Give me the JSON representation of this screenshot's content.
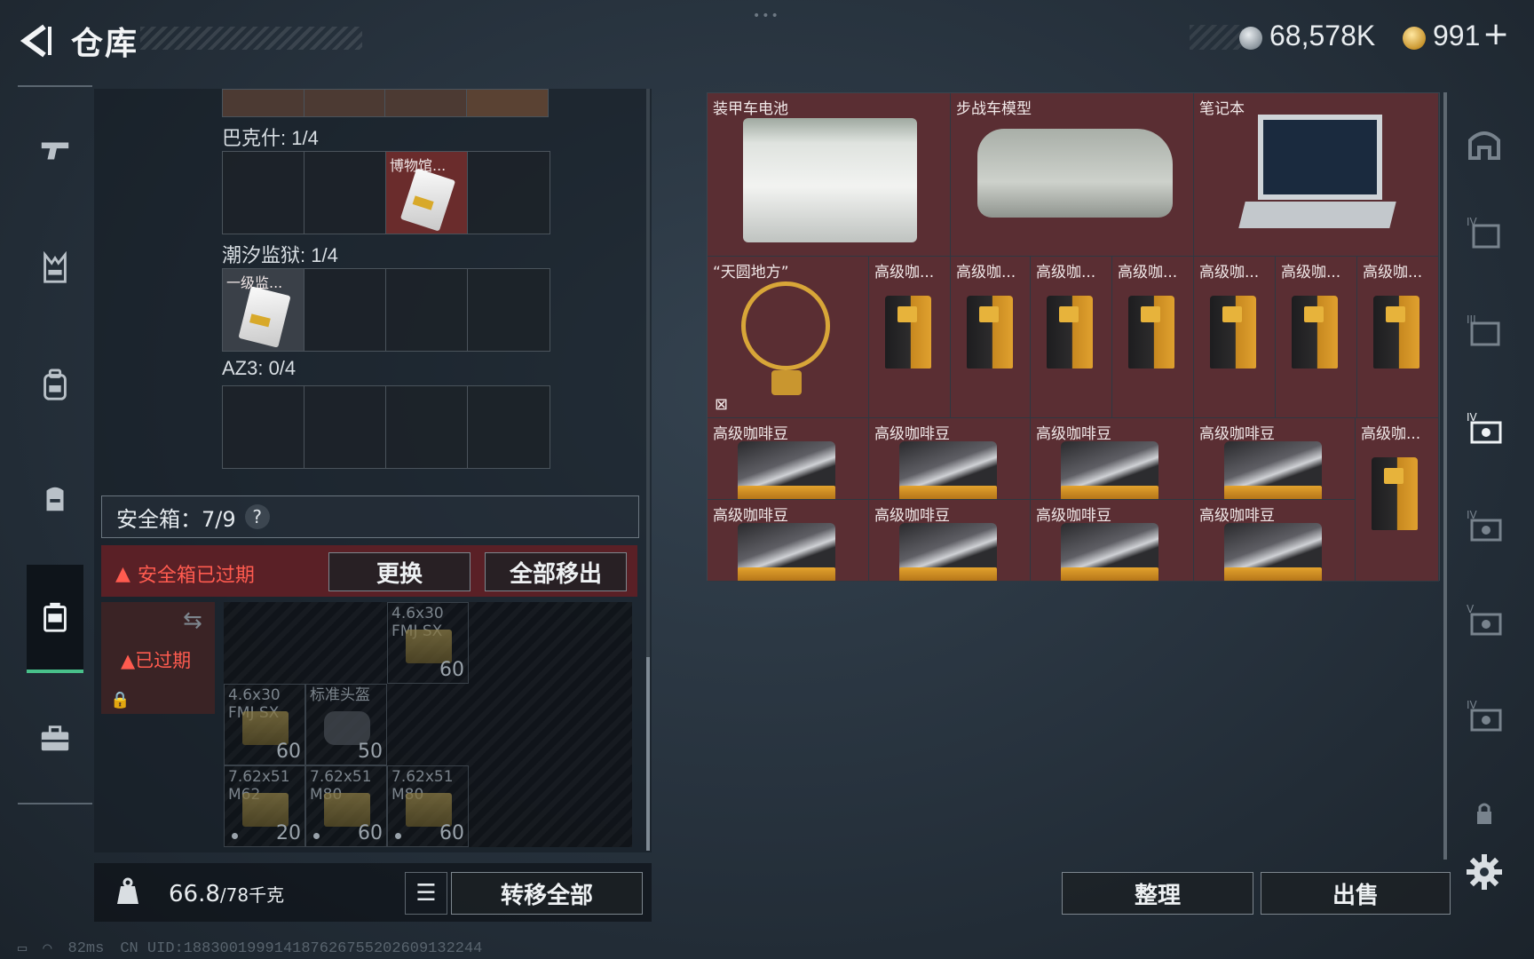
{
  "header": {
    "title": "仓库",
    "silver_amount": "68,578K",
    "gold_amount": "991",
    "plus_label": "+",
    "colors": {
      "accent_green": "#48c08a",
      "warning_red": "#ff5b4f",
      "item_bg": "#5a2e33"
    }
  },
  "left_nav": {
    "items": [
      {
        "name": "weapon",
        "icon": "pistol-icon"
      },
      {
        "name": "armor",
        "icon": "vest-icon"
      },
      {
        "name": "backpack",
        "icon": "backpack-icon"
      },
      {
        "name": "rig",
        "icon": "rig-icon"
      },
      {
        "name": "secure-case",
        "icon": "case-icon",
        "active": true
      },
      {
        "name": "toolbox",
        "icon": "briefcase-icon"
      }
    ]
  },
  "left_panel": {
    "collections": [
      {
        "label": "巴克什: 1/4",
        "item_label": "博物馆..."
      },
      {
        "label": "潮汐监狱: 1/4",
        "item_label": "一级监..."
      },
      {
        "label": "AZ3: 0/4"
      }
    ],
    "safe_box": {
      "title": "安全箱：7/9",
      "help": "?",
      "expired_warning": "安全箱已过期",
      "replace_label": "更换",
      "remove_all_label": "全部移出",
      "case_status": "已过期"
    },
    "ammo": [
      {
        "name": "4.6x30 FMJ SX",
        "count": "60"
      },
      {
        "name": "4.6x30 FMJ SX",
        "count": "60"
      },
      {
        "name": "标准头盔",
        "count": "50"
      },
      {
        "name": "7.62x51 M62",
        "count": "20"
      },
      {
        "name": "7.62x51 M80",
        "count": "60"
      },
      {
        "name": "7.62x51 M80",
        "count": "60"
      }
    ],
    "weight_value": "66.8",
    "weight_max": "/78千克",
    "transfer_all_label": "转移全部"
  },
  "stash": {
    "large_items": [
      {
        "label": "装甲车电池"
      },
      {
        "label": "步战车模型"
      },
      {
        "label": "笔记本"
      }
    ],
    "globe_label": "“天圆地方”",
    "coffee_short": "高级咖...",
    "coffee_full": "高级咖啡豆"
  },
  "bottom": {
    "organize_label": "整理",
    "sell_label": "出售"
  },
  "status": {
    "ping": "82ms",
    "uid": "CN UID:1883001999141876267552026091322​44"
  }
}
